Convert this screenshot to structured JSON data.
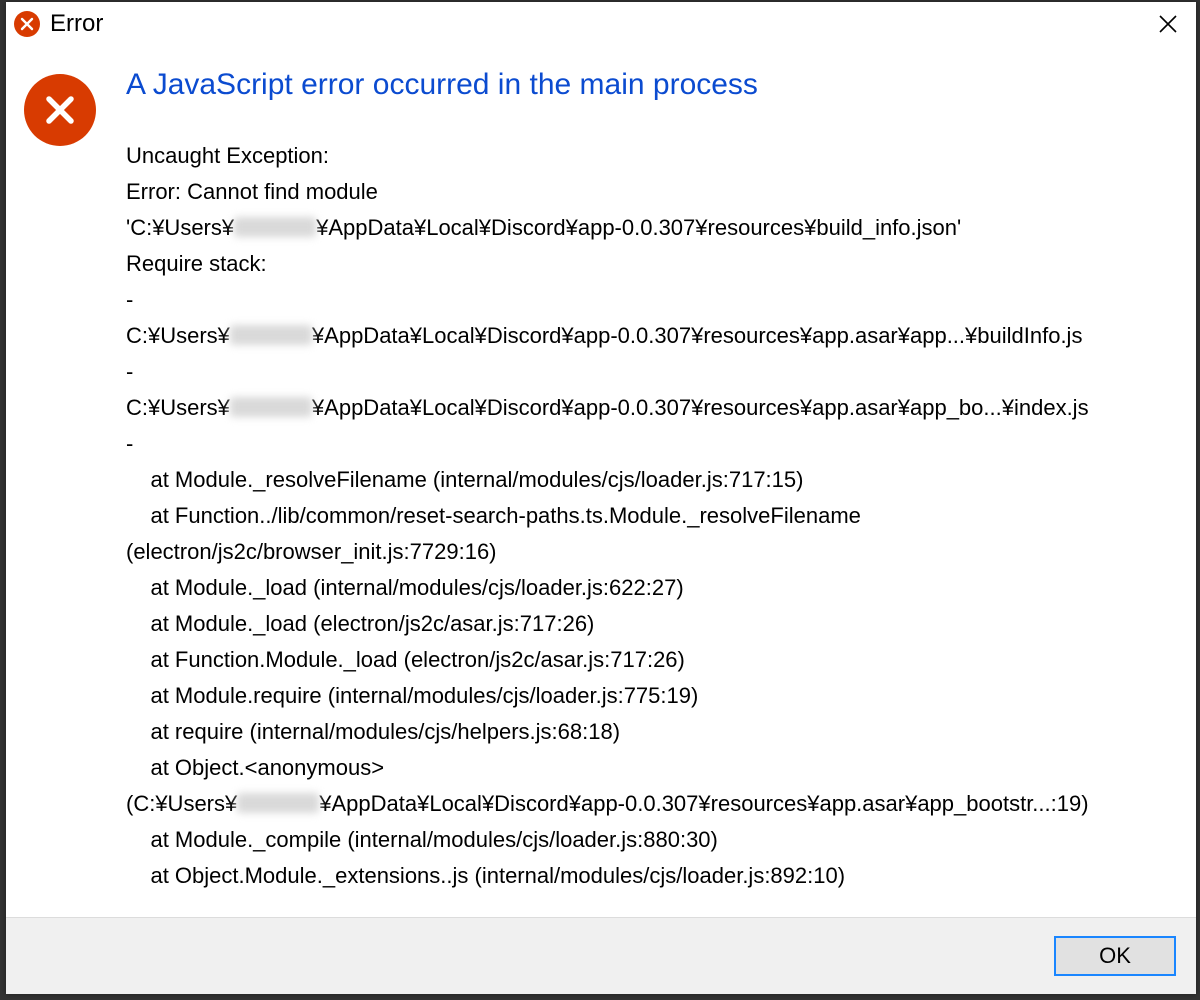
{
  "titlebar": {
    "title": "Error"
  },
  "dialog": {
    "heading": "A JavaScript error occurred in the main process",
    "redacted": "",
    "lines": [
      "Uncaught Exception:",
      "Error: Cannot find module",
      "'C:¥Users¥{R}¥AppData¥Local¥Discord¥app-0.0.307¥resources¥build_info.json'",
      "Require stack:",
      "-",
      "C:¥Users¥{R}¥AppData¥Local¥Discord¥app-0.0.307¥resources¥app.asar¥app...¥buildInfo.js",
      "-",
      "C:¥Users¥{R}¥AppData¥Local¥Discord¥app-0.0.307¥resources¥app.asar¥app_bo...¥index.js",
      "-",
      "    at Module._resolveFilename (internal/modules/cjs/loader.js:717:15)",
      "    at Function../lib/common/reset-search-paths.ts.Module._resolveFilename",
      "(electron/js2c/browser_init.js:7729:16)",
      "    at Module._load (internal/modules/cjs/loader.js:622:27)",
      "    at Module._load (electron/js2c/asar.js:717:26)",
      "    at Function.Module._load (electron/js2c/asar.js:717:26)",
      "    at Module.require (internal/modules/cjs/loader.js:775:19)",
      "    at require (internal/modules/cjs/helpers.js:68:18)",
      "    at Object.<anonymous>",
      "(C:¥Users¥{R}¥AppData¥Local¥Discord¥app-0.0.307¥resources¥app.asar¥app_bootstr...:19)",
      "    at Module._compile (internal/modules/cjs/loader.js:880:30)",
      "    at Object.Module._extensions..js (internal/modules/cjs/loader.js:892:10)"
    ]
  },
  "footer": {
    "ok_label": "OK"
  }
}
